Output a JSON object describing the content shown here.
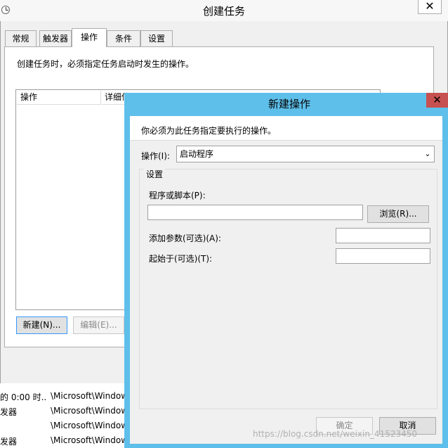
{
  "main_window": {
    "title": "创建任务",
    "close_glyph": "✕",
    "tabs": [
      {
        "label": "常规"
      },
      {
        "label": "触发器"
      },
      {
        "label": "操作"
      },
      {
        "label": "条件"
      },
      {
        "label": "设置"
      }
    ],
    "actions_tab": {
      "description": "创建任务时，必须指定任务启动时发生的操作。",
      "columns": [
        "操作",
        "详细信"
      ],
      "new_button": "新建(N)...",
      "edit_button": "编辑(E)..."
    }
  },
  "task_list": {
    "rows": [
      {
        "col1": "的 0:00 时...",
        "col2": "\\Microsoft\\Window"
      },
      {
        "col1": "发器",
        "col2": "\\Microsoft\\Window"
      },
      {
        "col1": "",
        "col2": "\\Microsoft\\Window"
      },
      {
        "col1": "发器",
        "col2": "\\Microsoft\\Window"
      }
    ]
  },
  "dialog": {
    "title": "新建操作",
    "close_glyph": "✕",
    "description": "你必须为此任务指定要执行的操作。",
    "action_label": "操作(I):",
    "action_value": "启动程序",
    "settings_legend": "设置",
    "program_label": "程序或脚本(P):",
    "program_value": "",
    "browse_button": "浏览(R)...",
    "args_label": "添加参数(可选)(A):",
    "args_value": "",
    "start_label": "起始于(可选)(T):",
    "start_value": "",
    "ok_button": "确定",
    "cancel_button": "取消"
  },
  "watermark": "https://blog.csdn.net/weixin_41523450",
  "colors": {
    "dialog_frame": "#5ebfea",
    "close_red": "#c75050",
    "focus_blue": "#3399ff"
  }
}
